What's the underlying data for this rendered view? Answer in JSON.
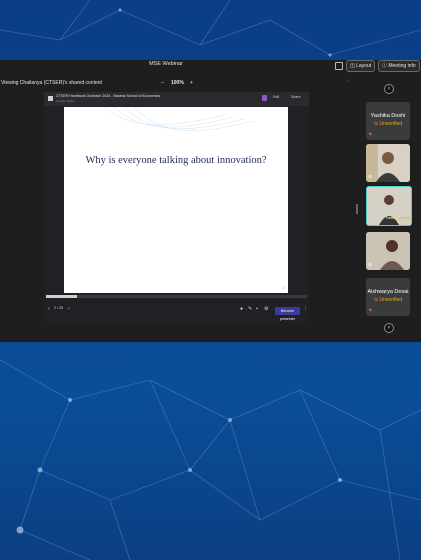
{
  "app": {
    "meeting_title": "MSE Webinar",
    "layout_label": "Layout",
    "meeting_info_label": "Meeting info",
    "viewing_label": "Viewing Chaitanya (CTSER)'s shared content",
    "zoom_minus": "–",
    "zoom_value": "100%",
    "zoom_plus": "+"
  },
  "shared_doc": {
    "title": "CTSER Handbook Outreach 2024 - Madras School of Economics",
    "subtitle": "Google Slides",
    "edit_label": "Edit",
    "share_label": "Share",
    "slide_heading": "Why is everyone talking about innovation?",
    "slide_number": "2",
    "progress": 0.12,
    "page_indicator": "2 / 25",
    "present_label": "Become presenter"
  },
  "participants": [
    {
      "name": "Yashika Doshi",
      "status": "Unverified",
      "type": "name"
    },
    {
      "name": "",
      "status": "",
      "type": "video"
    },
    {
      "name": "Narahari",
      "status": "Unverified",
      "type": "video-active"
    },
    {
      "name": "",
      "status": "",
      "type": "video"
    },
    {
      "name": "Aishwarya Desai",
      "status": "Unverified",
      "type": "name"
    }
  ],
  "colors": {
    "accent_unverified": "#e6a817",
    "active_border": "#4fd1c5",
    "meeting_bg": "#1e1e1e",
    "page_bg": "#0a4e98"
  },
  "icons": {
    "layout": "layout-icon",
    "info": "info-icon",
    "scroll_up": "chevron-up-icon",
    "scroll_down": "chevron-down-icon"
  }
}
